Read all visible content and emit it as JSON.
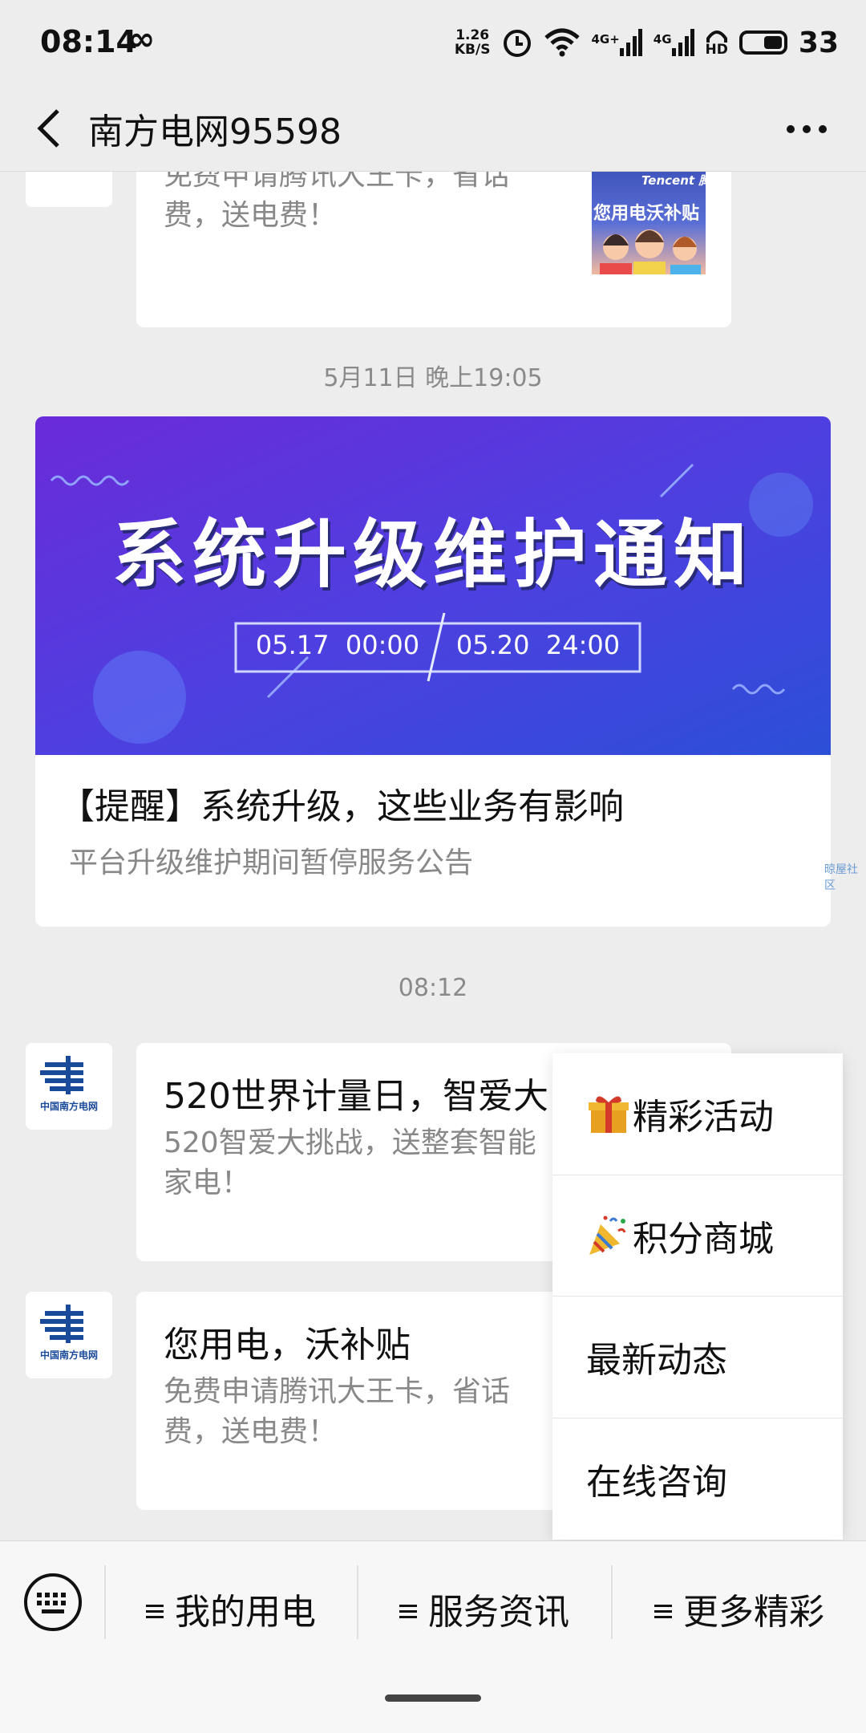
{
  "status_bar": {
    "time": "08:14",
    "loop_symbol": "∞",
    "net_speed_value": "1.26",
    "net_speed_unit": "KB/S",
    "sig1_label": "4G+",
    "sig2_label": "4G",
    "hd_label": "HD",
    "battery_level": "33"
  },
  "header": {
    "title": "南方电网95598"
  },
  "messages": {
    "top_card": {
      "desc": "免费申请腾讯大王卡，省话费，送电费！",
      "thumb_text": "您用电沃补贴",
      "thumb_brand": "Tencent 腾讯"
    },
    "timestamp_1": "5月11日 晚上19:05",
    "banner": {
      "headline": "系统升级维护通知",
      "date_start": "05.17  00:00",
      "date_end": "05.20  24:00",
      "title": "【提醒】系统升级，这些业务有影响",
      "subtitle": "平台升级维护期间暂停服务公告"
    },
    "timestamp_2": "08:12",
    "msg1": {
      "title": "520世界计量日，智爱大",
      "desc": "520智爱大挑战，送整套智能家电！"
    },
    "msg2": {
      "title": "您用电，沃补贴",
      "desc": "免费申请腾讯大王卡，省话费，送电费！"
    },
    "logo_text": "中国南方电网",
    "side_note": "晾屋社区"
  },
  "popup_menu": {
    "items": [
      {
        "label": "精彩活动",
        "icon": "gift-icon"
      },
      {
        "label": "积分商城",
        "icon": "party-popper-icon"
      },
      {
        "label": "最新动态",
        "icon": ""
      },
      {
        "label": "在线咨询",
        "icon": ""
      }
    ]
  },
  "bottom_menu": {
    "items": [
      "我的用电",
      "服务资讯",
      "更多精彩"
    ]
  }
}
